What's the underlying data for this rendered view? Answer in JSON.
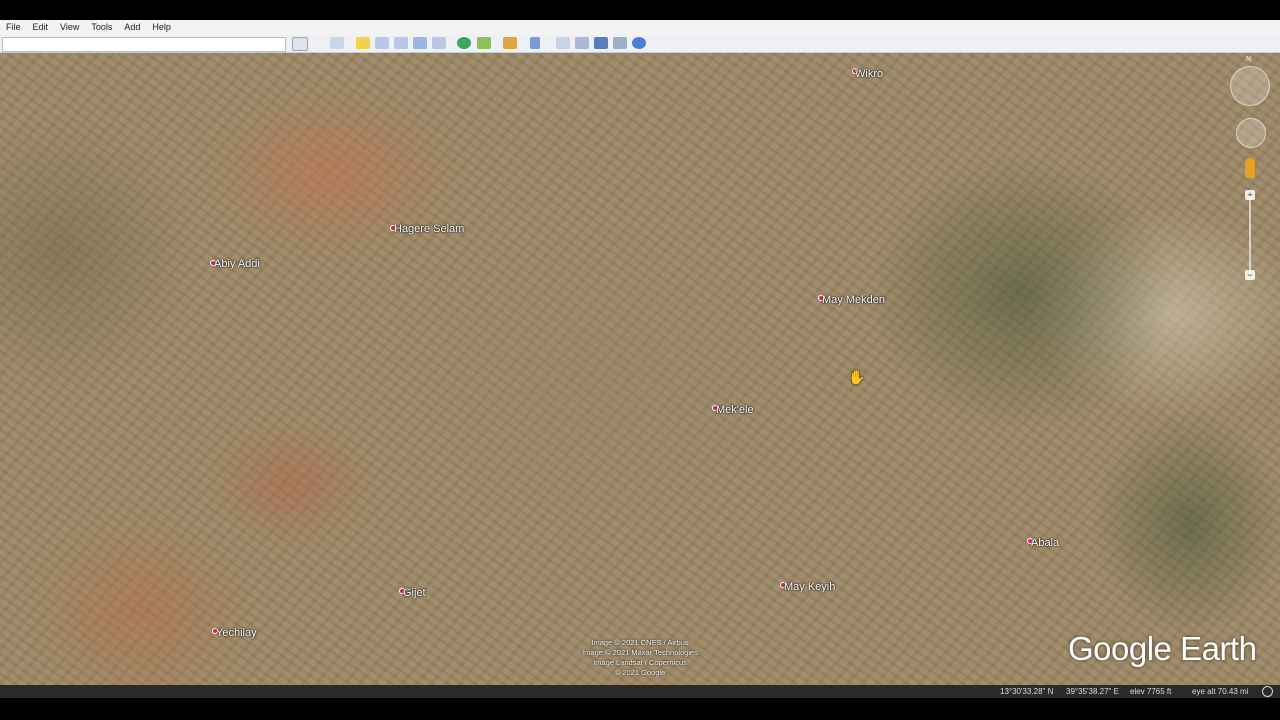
{
  "menu": [
    "File",
    "Edit",
    "View",
    "Tools",
    "Add",
    "Help"
  ],
  "search": {
    "placeholder": ""
  },
  "toolbar_icons": [
    "search-icon",
    "sidebar-icon",
    "placemark-icon",
    "polygon-icon",
    "path-icon",
    "image-overlay-icon",
    "tour-icon",
    "history-icon",
    "sunlight-icon",
    "planets-icon",
    "ruler-icon",
    "email-icon",
    "print-icon",
    "save-image-icon",
    "maps-icon",
    "earth-icon"
  ],
  "places": {
    "wikro": "Wikro",
    "hagere_selam": "Hagere Selam",
    "abiy_addi": "Abiy Addi",
    "may_mekden": "May Mekden",
    "mekele": "Mek'ele",
    "abala": "Abala",
    "may_keyih": "May Keyih",
    "gijet": "Gijet",
    "yechilay": "Yechilay"
  },
  "attribution": {
    "line1": "Image © 2021 CNES / Airbus",
    "line2": "Image © 2021 Maxar Technologies",
    "line3": "Image Landsat / Copernicus",
    "line4": "© 2021 Google"
  },
  "brand": "Google Earth",
  "status": {
    "lat": "13°30'33.28\" N",
    "lon": "39°35'38.27\" E",
    "elev": "elev 7765 ft",
    "eye": "eye alt 70.43 mi"
  },
  "compass": {
    "north": "N"
  },
  "colors": {
    "pin": "#e02060",
    "label": "#ffffff",
    "menubar": "#f3f3f3"
  }
}
